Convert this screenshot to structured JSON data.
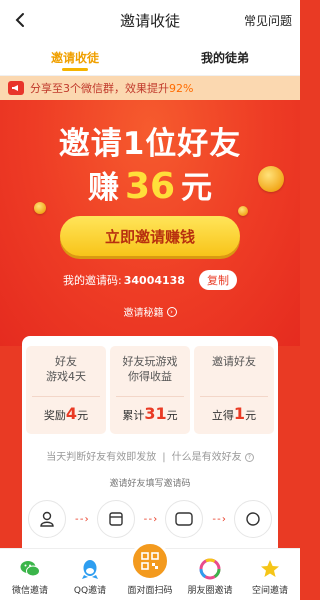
{
  "header": {
    "title": "邀请收徒",
    "faq_label": "常见问题",
    "back_icon": "back-arrow-icon"
  },
  "tabs": [
    {
      "label": "邀请收徒",
      "active": true
    },
    {
      "label": "我的徒弟",
      "active": false
    }
  ],
  "notice": {
    "prefix": "分享至3个微信群，效果提升",
    "percent": "92%"
  },
  "hero": {
    "line1": "邀请1位好友",
    "earn_prefix": "赚",
    "amount": "36",
    "earn_suffix": "元",
    "button_label": "立即邀请赚钱",
    "code_label": "我的邀请码:",
    "code_value": "34004138",
    "copy_label": "复制",
    "tips_label": "邀请秘籍"
  },
  "rewards": [
    {
      "desc": "好友\n游戏4天",
      "prefix": "奖励",
      "amount": "4",
      "unit": "元"
    },
    {
      "desc": "好友玩游戏\n你得收益",
      "prefix": "累计",
      "amount": "31",
      "unit": "元"
    },
    {
      "desc": "邀请好友",
      "prefix": "立得",
      "amount": "1",
      "unit": "元"
    }
  ],
  "rules": {
    "left": "当天判断好友有效即发放",
    "right": "什么是有效好友"
  },
  "steps": {
    "title": "邀请好友填写邀请码",
    "icons": [
      "user-icon",
      "app-icon",
      "chat-icon",
      "circle-icon"
    ]
  },
  "share_bar": [
    {
      "label": "微信邀请",
      "icon": "wechat-icon",
      "color": "#3bb54a"
    },
    {
      "label": "QQ邀请",
      "icon": "qq-icon",
      "color": "#2e9ef0"
    },
    {
      "label": "面对面扫码",
      "icon": "qr-scan-icon",
      "color": "#f39a1e"
    },
    {
      "label": "朋友圈邀请",
      "icon": "moments-icon",
      "color": "#e94b8c"
    },
    {
      "label": "空间邀请",
      "icon": "qzone-star-icon",
      "color": "#f5c518"
    }
  ],
  "colors": {
    "brand_red": "#e93a24",
    "accent_yellow": "#ffdf3a",
    "tab_active": "#f0a000"
  }
}
